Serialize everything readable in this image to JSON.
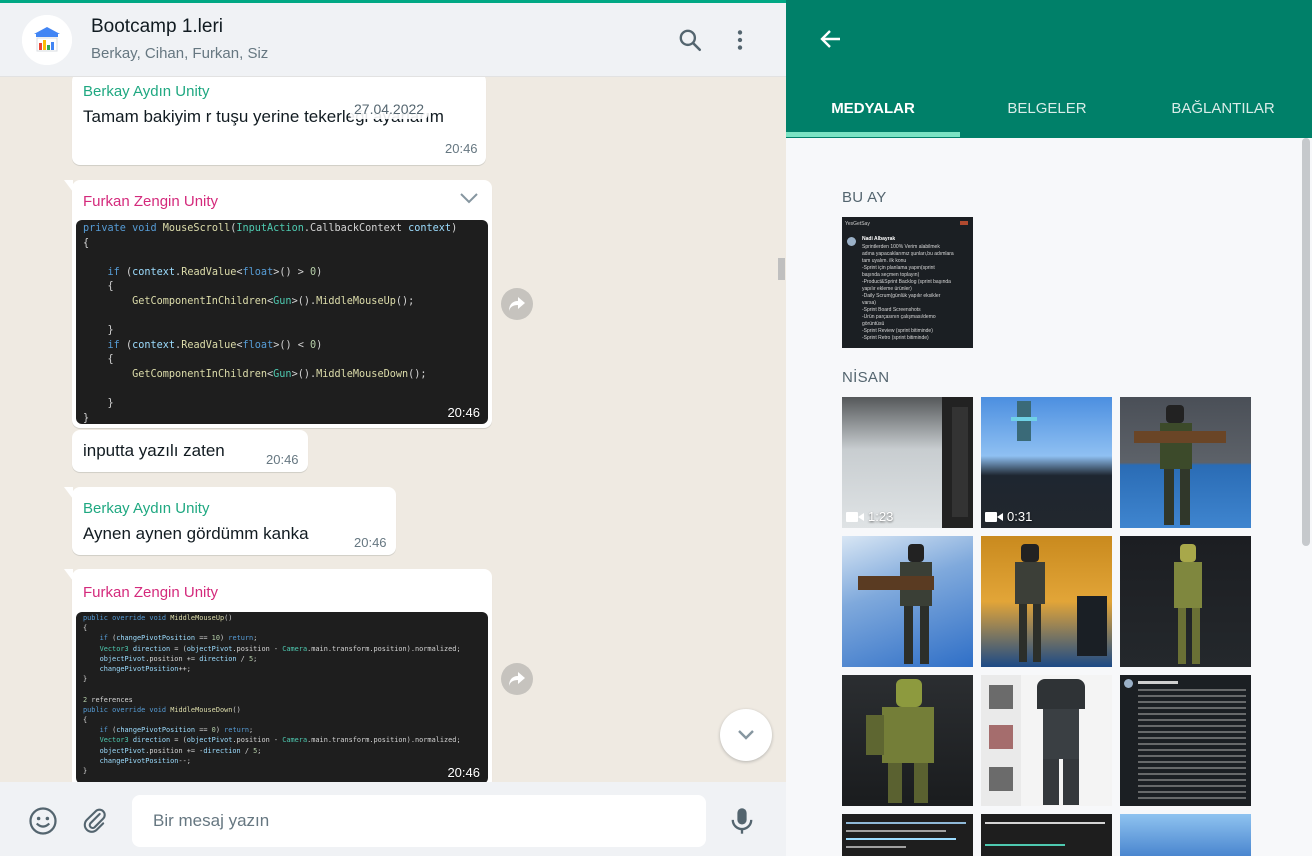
{
  "chat": {
    "title": "Bootcamp 1.leri",
    "members": "Berkay, Cihan, Furkan, Siz",
    "date_chip": "27.04.2022",
    "messages": [
      {
        "sender": "Berkay Aydın Unity",
        "text": "Tamam bakiyim r tuşu yerine tekerleği ayarlarım",
        "time": "20:46"
      },
      {
        "sender": "Furkan Zengin Unity",
        "type": "image",
        "time": "20:46"
      },
      {
        "text": "inputta yazılı zaten",
        "time": "20:46"
      },
      {
        "sender": "Berkay Aydın Unity",
        "text": "Aynen aynen gördümm kanka",
        "time": "20:46"
      },
      {
        "sender": "Furkan Zengin Unity",
        "type": "image",
        "time": "20:46"
      }
    ],
    "code1": [
      "private void MouseScroll(InputAction.CallbackContext context)",
      "{",
      "",
      "    if (context.ReadValue<float>() > 0)",
      "    {",
      "        GetComponentInChildren<Gun>().MiddleMouseUp();",
      "",
      "    }",
      "    if (context.ReadValue<float>() < 0)",
      "    {",
      "        GetComponentInChildren<Gun>().MiddleMouseDown();",
      "",
      "    }",
      "}"
    ],
    "code2": [
      "public override void MiddleMouseUp()",
      "{",
      "    if (changePivotPosition == 10) return;",
      "    Vector3 direction = (objectPivot.position - Camera.main.transform.position).normalized;",
      "    objectPivot.position += direction / 5;",
      "    changePivotPosition++;",
      "}",
      "",
      "2 references",
      "public override void MiddleMouseDown()",
      "{",
      "    if (changePivotPosition == 0) return;",
      "    Vector3 direction = (objectPivot.position - Camera.main.transform.position).normalized;",
      "    objectPivot.position += -direction / 5;",
      "    changePivotPosition--;",
      "}"
    ],
    "compose_placeholder": "Bir mesaj yazın"
  },
  "media_panel": {
    "tabs": [
      "MEDYALAR",
      "BELGELER",
      "BAĞLANTILAR"
    ],
    "active_tab": "MEDYALAR",
    "sections": [
      {
        "label": "BU AY"
      },
      {
        "label": "NİSAN"
      }
    ],
    "doc_thumb": {
      "app": "YesGetSay",
      "author": "Nadi Albayrak",
      "lines": [
        "Sprintlerden 100% Verim alabilmek",
        "adına yapacaklarımız şunları,bu adımlara",
        "tam uyalım. ilk konu",
        "-Sprint için planlama yapın(sprint",
        "başında seçmen toplayın)",
        "-Product&Sprint Backlog (sprint başında",
        "yapılır ekleme ürünler)",
        "-Daily Scrum(günlük yapılır eksikler",
        "varsa)",
        "-Sprint Board Screenshots",
        "-Ürün parçasının çalışması/demo",
        "görüntüsü",
        "-Sprint Review (sprint bitiminde)",
        "-Sprint Retro (sprint bitiminde)"
      ]
    },
    "videos": [
      {
        "duration": "1:23"
      },
      {
        "duration": "0:31"
      }
    ],
    "accent": "#008069"
  }
}
